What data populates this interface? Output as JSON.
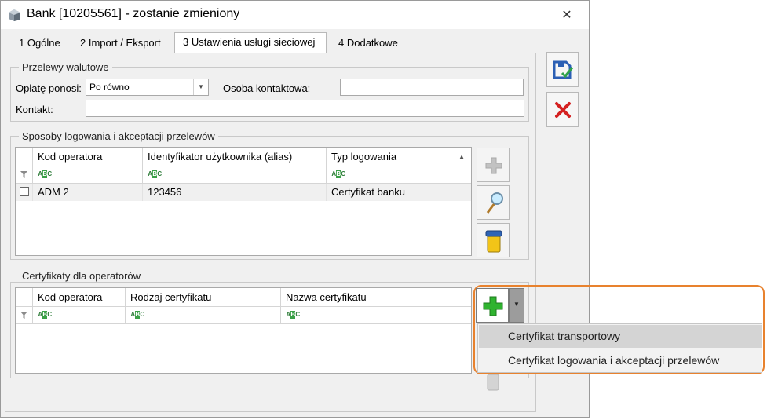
{
  "window": {
    "title": "Bank [10205561] - zostanie zmieniony",
    "close_glyph": "✕"
  },
  "tabs": [
    {
      "label": "1 Ogólne",
      "active": false
    },
    {
      "label": "2 Import / Eksport",
      "active": false
    },
    {
      "label": "3 Ustawienia usługi sieciowej",
      "active": true
    },
    {
      "label": "4 Dodatkowe",
      "active": false
    }
  ],
  "transfers": {
    "group_title": "Przelewy walutowe",
    "fee_label": "Opłatę ponosi:",
    "fee_value": "Po równo",
    "contact_person_label": "Osoba kontaktowa:",
    "contact_person_value": "",
    "contact_label": "Kontakt:",
    "contact_value": ""
  },
  "logins": {
    "group_title": "Sposoby logowania i akceptacji przelewów",
    "columns": [
      "Kod operatora",
      "Identyfikator użytkownika (alias)",
      "Typ logowania"
    ],
    "filter_glyph": "ABC",
    "rows": [
      {
        "code": "ADM 2",
        "alias": "123456",
        "type": "Certyfikat banku"
      }
    ]
  },
  "certs": {
    "group_title": "Certyfikaty dla operatorów",
    "columns": [
      "Kod operatora",
      "Rodzaj certyfikatu",
      "Nazwa certyfikatu"
    ]
  },
  "dropdown_menu": {
    "items": [
      {
        "label": "Certyfikat transportowy",
        "highlighted": true
      },
      {
        "label": "Certyfikat logowania i akceptacji przelewów",
        "highlighted": false
      }
    ]
  },
  "colors": {
    "accent_orange": "#e8822e",
    "save_blue": "#2b5fb4",
    "cancel_red": "#d42020",
    "add_green": "#2fb32f"
  }
}
